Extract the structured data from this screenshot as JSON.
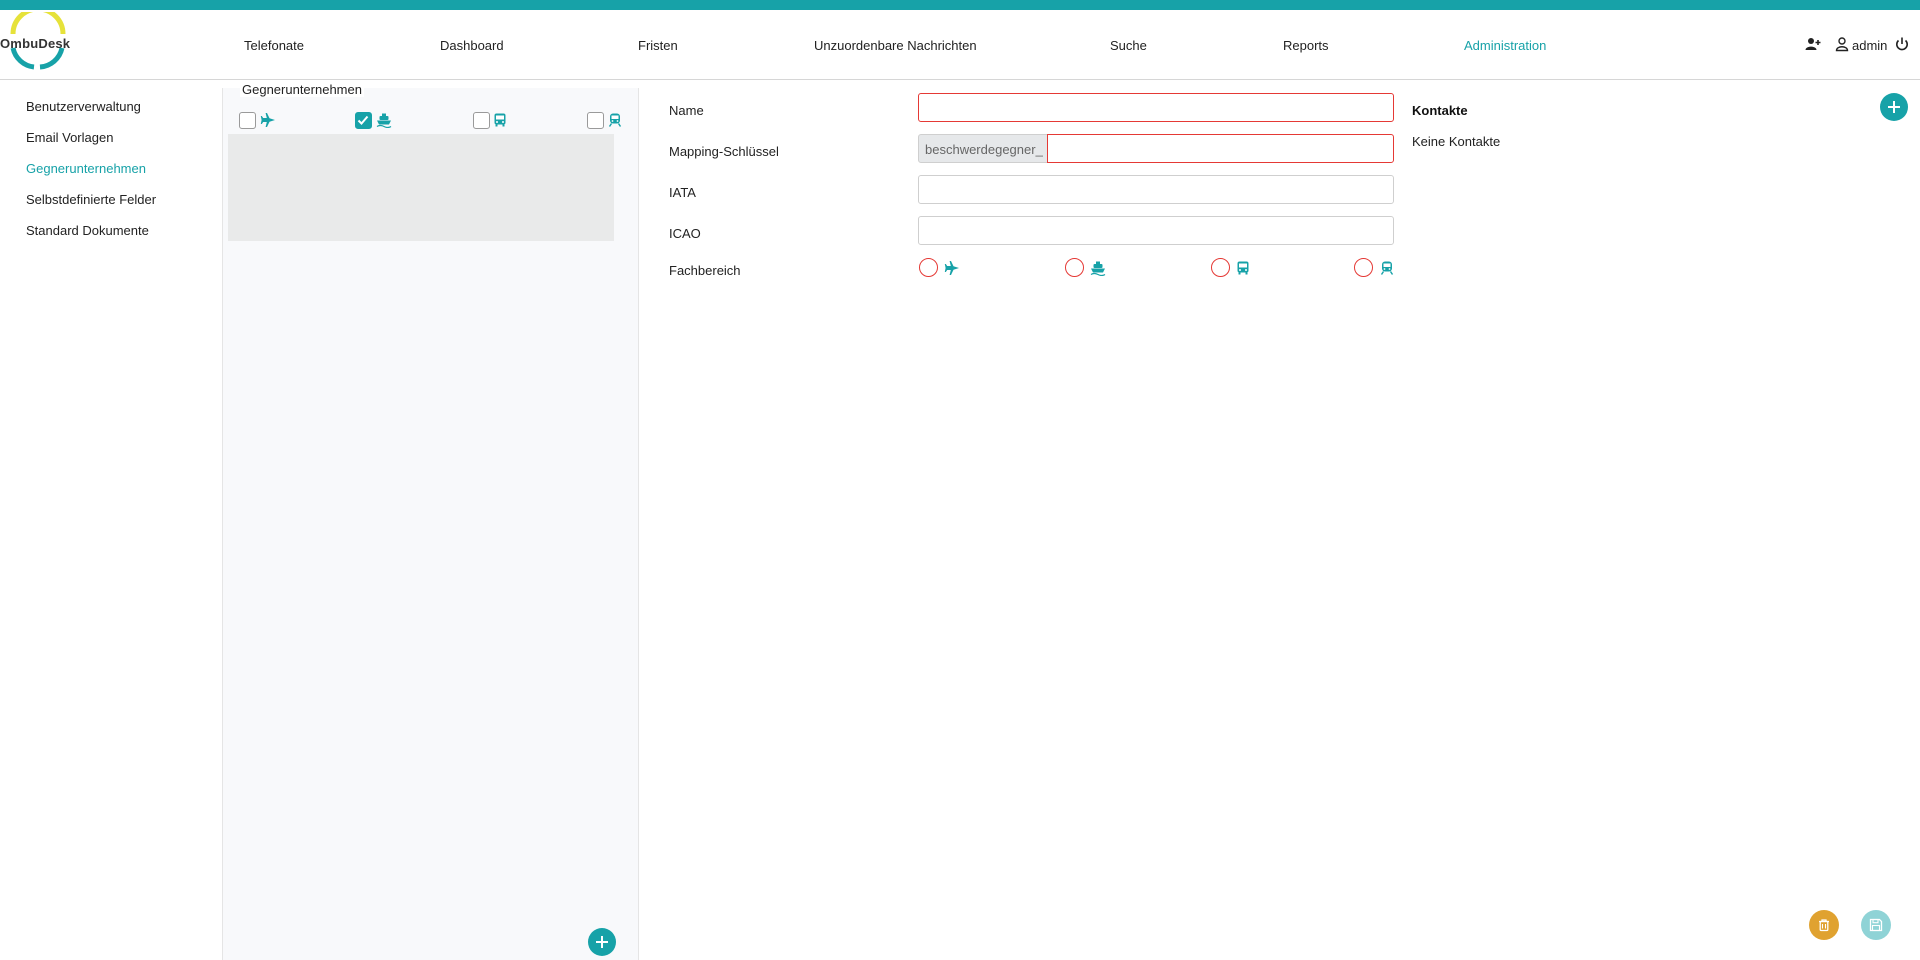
{
  "app": {
    "logo_text": "OmbuDesk",
    "accent": "#17a2a8"
  },
  "nav": {
    "items": [
      {
        "label": "Telefonate"
      },
      {
        "label": "Dashboard"
      },
      {
        "label": "Fristen"
      },
      {
        "label": "Unzuordenbare Nachrichten"
      },
      {
        "label": "Suche"
      },
      {
        "label": "Reports"
      },
      {
        "label": "Administration",
        "active": true
      }
    ],
    "user": {
      "name": "admin",
      "icons": [
        "add-user-icon",
        "user-icon",
        "power-icon"
      ]
    }
  },
  "sidebar": {
    "items": [
      {
        "label": "Benutzerverwaltung"
      },
      {
        "label": "Email Vorlagen"
      },
      {
        "label": "Gegnerunternehmen",
        "active": true
      },
      {
        "label": "Selbstdefinierte Felder"
      },
      {
        "label": "Standard Dokumente"
      }
    ]
  },
  "list_panel": {
    "title": "Gegnerunternehmen",
    "filters": [
      {
        "icon": "plane-icon",
        "checked": false
      },
      {
        "icon": "ship-icon",
        "checked": true
      },
      {
        "icon": "bus-icon",
        "checked": false
      },
      {
        "icon": "train-icon",
        "checked": false
      }
    ]
  },
  "form": {
    "name": {
      "label": "Name",
      "value": ""
    },
    "mapping": {
      "label": "Mapping-Schlüssel",
      "prefix": "beschwerdegegner_",
      "value": ""
    },
    "iata": {
      "label": "IATA",
      "value": ""
    },
    "icao": {
      "label": "ICAO",
      "value": ""
    },
    "fachbereich": {
      "label": "Fachbereich",
      "options": [
        "plane-icon",
        "ship-icon",
        "bus-icon",
        "train-icon"
      ]
    }
  },
  "contacts": {
    "title": "Kontakte",
    "empty_text": "Keine Kontakte"
  },
  "actions": {
    "delete_color": "#e0a230",
    "save_color": "#8fd3d6"
  }
}
